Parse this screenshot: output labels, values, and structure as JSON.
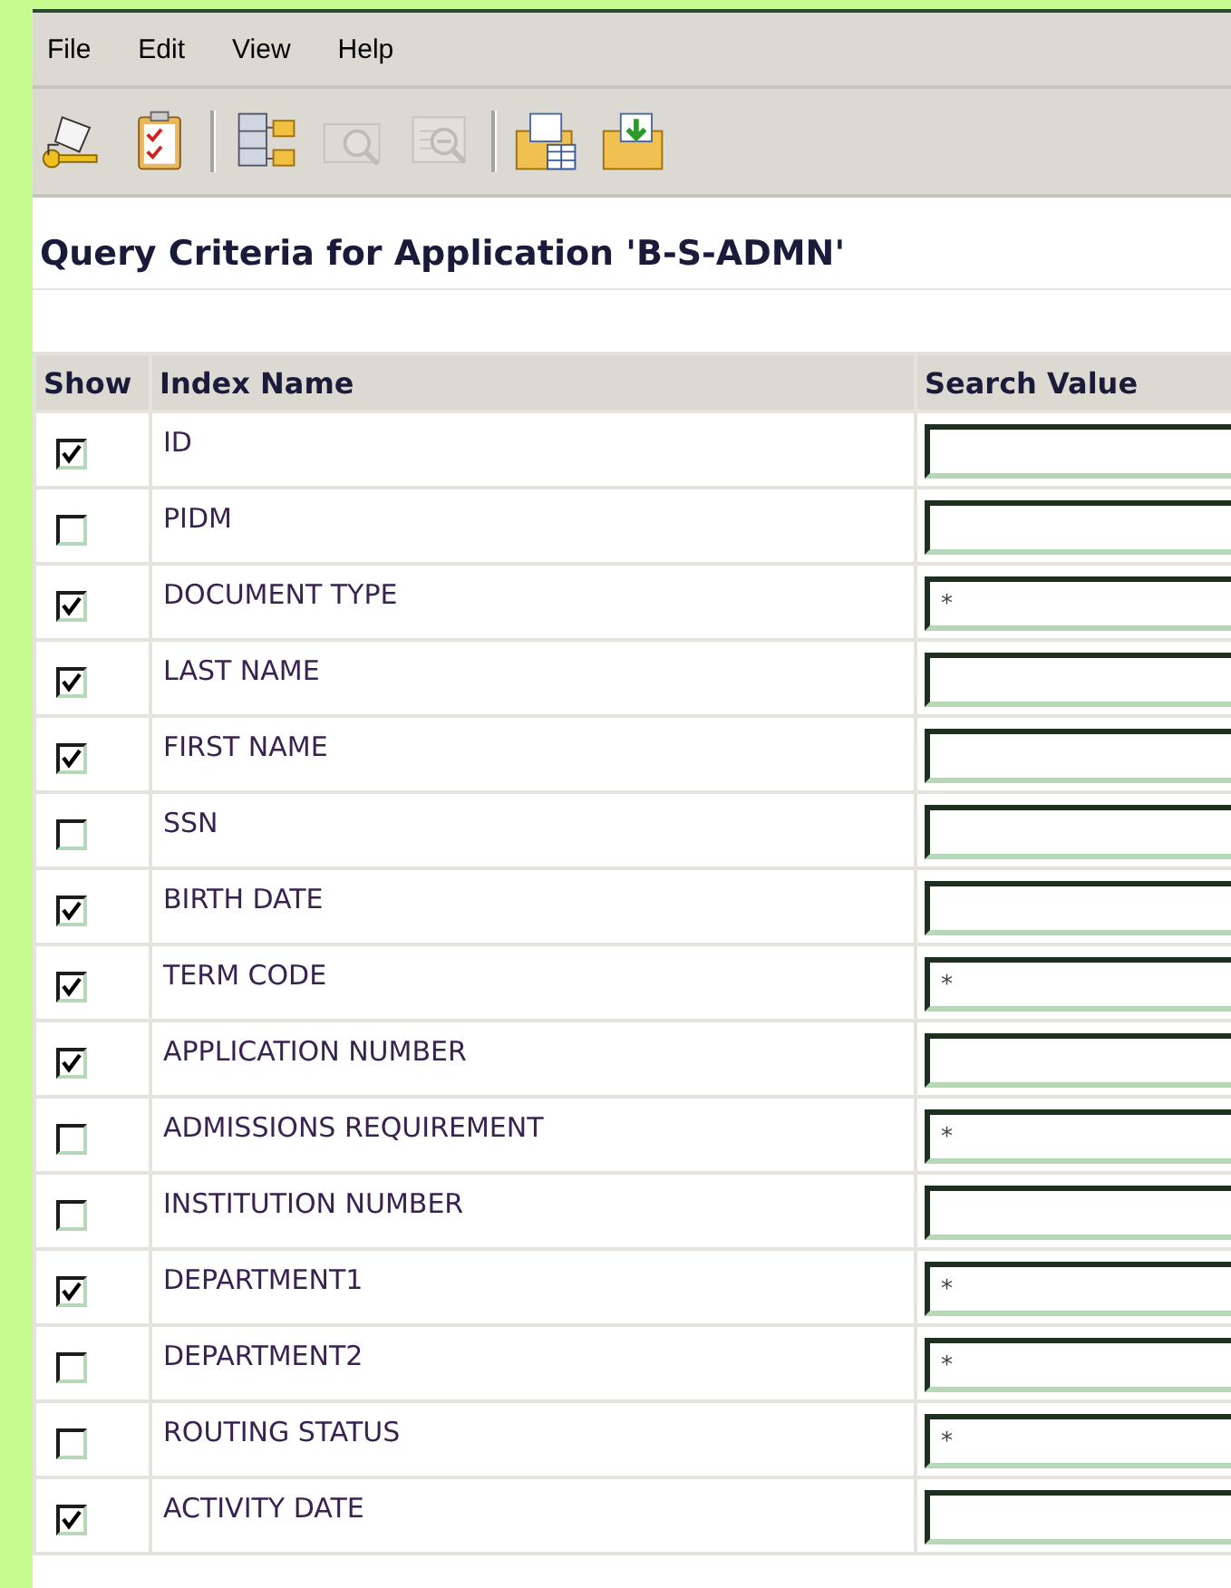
{
  "menu": [
    "File",
    "Edit",
    "View",
    "Help"
  ],
  "toolbar": [
    {
      "kind": "key",
      "disabled": false
    },
    {
      "kind": "checklist",
      "disabled": false
    },
    {
      "kind": "separator"
    },
    {
      "kind": "tree",
      "disabled": false
    },
    {
      "kind": "folder-search",
      "disabled": true
    },
    {
      "kind": "doc-search",
      "disabled": true
    },
    {
      "kind": "separator"
    },
    {
      "kind": "folder-table",
      "disabled": false
    },
    {
      "kind": "folder-download",
      "disabled": false
    }
  ],
  "title": "Query Criteria for Application 'B-S-ADMN'",
  "table": {
    "columns": [
      "Show",
      "Index Name",
      "Search Value"
    ],
    "rows": [
      {
        "show": true,
        "name": "ID",
        "value": ""
      },
      {
        "show": false,
        "name": "PIDM",
        "value": ""
      },
      {
        "show": true,
        "name": "DOCUMENT TYPE",
        "value": "*"
      },
      {
        "show": true,
        "name": "LAST NAME",
        "value": ""
      },
      {
        "show": true,
        "name": "FIRST NAME",
        "value": ""
      },
      {
        "show": false,
        "name": "SSN",
        "value": ""
      },
      {
        "show": true,
        "name": "BIRTH DATE",
        "value": ""
      },
      {
        "show": true,
        "name": "TERM CODE",
        "value": "*"
      },
      {
        "show": true,
        "name": "APPLICATION NUMBER",
        "value": ""
      },
      {
        "show": false,
        "name": "ADMISSIONS REQUIREMENT",
        "value": "*"
      },
      {
        "show": false,
        "name": "INSTITUTION NUMBER",
        "value": ""
      },
      {
        "show": true,
        "name": "DEPARTMENT1",
        "value": "*"
      },
      {
        "show": false,
        "name": "DEPARTMENT2",
        "value": "*"
      },
      {
        "show": false,
        "name": "ROUTING STATUS",
        "value": "*"
      },
      {
        "show": true,
        "name": "ACTIVITY DATE",
        "value": ""
      }
    ]
  }
}
